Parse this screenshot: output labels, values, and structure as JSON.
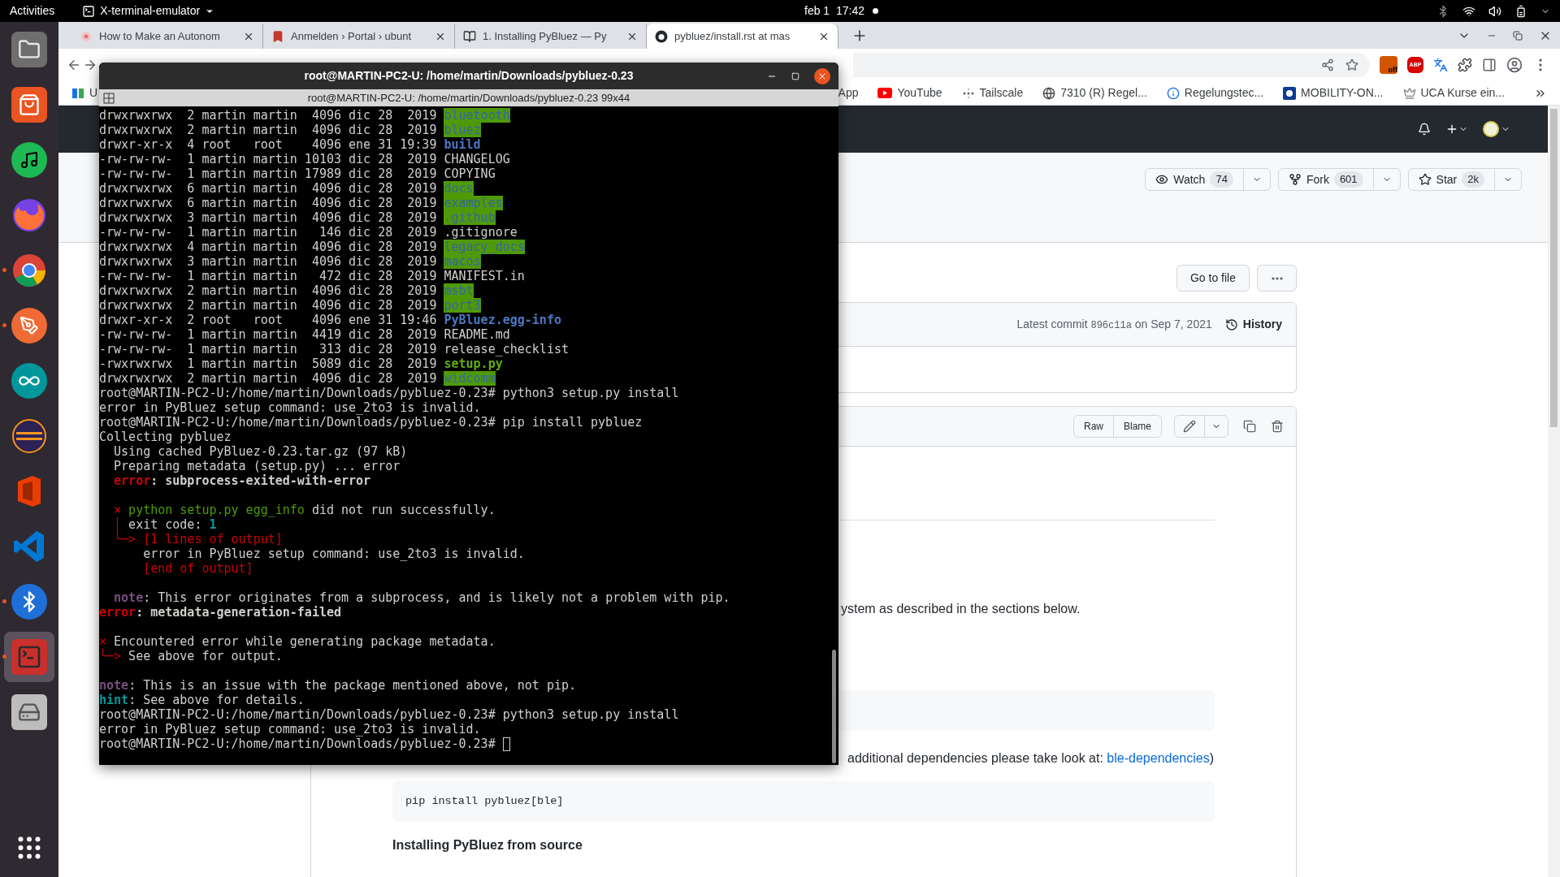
{
  "top_bar": {
    "activities": "Activities",
    "app_menu": "X-terminal-emulator",
    "clock": "feb 1  17:42",
    "notification": true
  },
  "dock": {
    "items": [
      {
        "kind": "files",
        "running": false,
        "selected": false
      },
      {
        "kind": "store",
        "running": false,
        "selected": false
      },
      {
        "kind": "music",
        "running": false,
        "selected": false
      },
      {
        "kind": "fox",
        "running": false,
        "selected": false
      },
      {
        "kind": "chrome",
        "running": true,
        "selected": false
      },
      {
        "kind": "pen",
        "running": true,
        "selected": false
      },
      {
        "kind": "infinity",
        "running": false,
        "selected": false
      },
      {
        "kind": "eclipse",
        "running": false,
        "selected": false
      },
      {
        "kind": "office",
        "running": false,
        "selected": false
      },
      {
        "kind": "code",
        "running": false,
        "selected": false
      },
      {
        "kind": "bluetooth",
        "running": true,
        "selected": false
      },
      {
        "kind": "terminal",
        "running": true,
        "selected": true
      },
      {
        "kind": "drive",
        "running": false,
        "selected": false
      }
    ]
  },
  "browser": {
    "tabs": [
      {
        "title": "How to Make an Autonom",
        "selected": false
      },
      {
        "title": "Anmelden › Portal › ubunt",
        "selected": false
      },
      {
        "title": "1. Installing PyBluez — Py",
        "selected": false
      },
      {
        "title": "pybluez/install.rst at mas",
        "selected": true
      }
    ],
    "extensions": [
      {
        "kind": "badge",
        "label": "off"
      },
      {
        "kind": "octagon",
        "label": "ABP"
      },
      {
        "kind": "translate"
      },
      {
        "kind": "puzzle"
      }
    ],
    "bookmarks": [
      {
        "label": "U"
      },
      {
        "label": "App"
      },
      {
        "label": "YouTube"
      },
      {
        "label": "Tailscale"
      },
      {
        "label": "7310 (R) Regel..."
      },
      {
        "label": "Regelungstec..."
      },
      {
        "label": "MOBILITY-ON..."
      },
      {
        "label": "UCA Kurse ein..."
      }
    ]
  },
  "github": {
    "watch": {
      "label": "Watch",
      "count": "74"
    },
    "fork": {
      "label": "Fork",
      "count": "601"
    },
    "star": {
      "label": "Star",
      "count": "2k"
    },
    "go_to_file": "Go to file",
    "commit": {
      "prefix": "Latest commit",
      "sha": "896c11a",
      "date": "on Sep 7, 2021"
    },
    "history": "History",
    "file_buttons": [
      "Raw",
      "Blame"
    ],
    "paragraph_1": "ystem as described in the sections below.",
    "paragraph_2": {
      "text": "additional dependencies please take look at:",
      "link": "ble-dependencies",
      "suffix": ")"
    },
    "code_block": "pip install pybluez[ble]",
    "heading": "Installing PyBluez from source"
  },
  "terminal": {
    "title": "root@MARTIN-PC2-U: /home/martin/Downloads/pybluez-0.23",
    "subtitle": "root@MARTIN-PC2-U: /home/martin/Downloads/pybluez-0.23 99x44",
    "cursor": true,
    "lines": [
      {
        "segments": [
          {
            "text": "drwxrwxrwx  2 martin martin  4096 dic 28  2019 ",
            "kind": "plain"
          },
          {
            "text": "bluetooth",
            "kind": "dir"
          }
        ]
      },
      {
        "segments": [
          {
            "text": "drwxrwxrwx  2 martin martin  4096 dic 28  2019 ",
            "kind": "plain"
          },
          {
            "text": "bluez",
            "kind": "dir"
          }
        ]
      },
      {
        "segments": [
          {
            "text": "drwxr-xr-x  4 root   root    4096 ene 31 19:39 ",
            "kind": "plain"
          },
          {
            "text": "build",
            "kind": "dirbold"
          }
        ]
      },
      {
        "segments": [
          {
            "text": "-rw-rw-rw-  1 martin martin 10103 dic 28  2019 CHANGELOG",
            "kind": "plain"
          }
        ]
      },
      {
        "segments": [
          {
            "text": "-rw-rw-rw-  1 martin martin 17989 dic 28  2019 COPYING",
            "kind": "plain"
          }
        ]
      },
      {
        "segments": [
          {
            "text": "drwxrwxrwx  6 martin martin  4096 dic 28  2019 ",
            "kind": "plain"
          },
          {
            "text": "docs",
            "kind": "dir"
          }
        ]
      },
      {
        "segments": [
          {
            "text": "drwxrwxrwx  6 martin martin  4096 dic 28  2019 ",
            "kind": "plain"
          },
          {
            "text": "examples",
            "kind": "dir"
          }
        ]
      },
      {
        "segments": [
          {
            "text": "drwxrwxrwx  3 martin martin  4096 dic 28  2019 ",
            "kind": "plain"
          },
          {
            "text": ".github",
            "kind": "dir"
          }
        ]
      },
      {
        "segments": [
          {
            "text": "-rw-rw-rw-  1 martin martin   146 dic 28  2019 .gitignore",
            "kind": "plain"
          }
        ]
      },
      {
        "segments": [
          {
            "text": "drwxrwxrwx  4 martin martin  4096 dic 28  2019 ",
            "kind": "plain"
          },
          {
            "text": "legacy_docs",
            "kind": "dir"
          }
        ]
      },
      {
        "segments": [
          {
            "text": "drwxrwxrwx  3 martin martin  4096 dic 28  2019 ",
            "kind": "plain"
          },
          {
            "text": "macos",
            "kind": "dir"
          }
        ]
      },
      {
        "segments": [
          {
            "text": "-rw-rw-rw-  1 martin martin   472 dic 28  2019 MANIFEST.in",
            "kind": "plain"
          }
        ]
      },
      {
        "segments": [
          {
            "text": "drwxrwxrwx  2 martin martin  4096 dic 28  2019 ",
            "kind": "plain"
          },
          {
            "text": "msbt",
            "kind": "dir"
          }
        ]
      },
      {
        "segments": [
          {
            "text": "drwxrwxrwx  2 martin martin  4096 dic 28  2019 ",
            "kind": "plain"
          },
          {
            "text": "port3",
            "kind": "dir"
          }
        ]
      },
      {
        "segments": [
          {
            "text": "drwxr-xr-x  2 root   root    4096 ene 31 19:46 ",
            "kind": "plain"
          },
          {
            "text": "PyBluez.egg-info",
            "kind": "dirbold"
          }
        ]
      },
      {
        "segments": [
          {
            "text": "-rw-rw-rw-  1 martin martin  4419 dic 28  2019 README.md",
            "kind": "plain"
          }
        ]
      },
      {
        "segments": [
          {
            "text": "-rw-rw-rw-  1 martin martin   313 dic 28  2019 release_checklist",
            "kind": "plain"
          }
        ]
      },
      {
        "segments": [
          {
            "text": "-rwxrwxrwx  1 martin martin  5089 dic 28  2019 ",
            "kind": "plain"
          },
          {
            "text": "setup.py",
            "kind": "exec"
          }
        ]
      },
      {
        "segments": [
          {
            "text": "drwxrwxrwx  2 martin martin  4096 dic 28  2019 ",
            "kind": "plain"
          },
          {
            "text": "widcomm",
            "kind": "dir"
          }
        ]
      },
      {
        "segments": [
          {
            "text": "root@MARTIN-PC2-U:/home/martin/Downloads/pybluez-0.23# python3 setup.py install",
            "kind": "plain"
          }
        ]
      },
      {
        "segments": [
          {
            "text": "error in PyBluez setup command: use_2to3 is invalid.",
            "kind": "plain"
          }
        ]
      },
      {
        "segments": [
          {
            "text": "root@MARTIN-PC2-U:/home/martin/Downloads/pybluez-0.23# pip install pybluez",
            "kind": "plain"
          }
        ]
      },
      {
        "segments": [
          {
            "text": "Collecting pybluez",
            "kind": "plain"
          }
        ]
      },
      {
        "segments": [
          {
            "text": "  Using cached PyBluez-0.23.tar.gz (97 kB)",
            "kind": "plain"
          }
        ]
      },
      {
        "segments": [
          {
            "text": "  Preparing metadata (setup.py) ... error",
            "kind": "plain"
          }
        ]
      },
      {
        "segments": [
          {
            "text": "  error",
            "kind": "redbold"
          },
          {
            "text": ": subprocess-exited-with-error",
            "kind": "bold"
          }
        ]
      },
      {
        "kind": "blank"
      },
      {
        "segments": [
          {
            "text": "  ×",
            "kind": "red"
          },
          {
            "text": " python setup.py egg_info",
            "kind": "green"
          },
          {
            "text": " did not run successfully.",
            "kind": "plain"
          }
        ]
      },
      {
        "segments": [
          {
            "text": "  │",
            "kind": "red"
          },
          {
            "text": " exit code: ",
            "kind": "plain"
          },
          {
            "text": "1",
            "kind": "cyan"
          }
        ]
      },
      {
        "segments": [
          {
            "text": "  ╰─> [1 lines of output]",
            "kind": "red"
          }
        ]
      },
      {
        "segments": [
          {
            "text": "      error in PyBluez setup command: use_2to3 is invalid.",
            "kind": "plain"
          }
        ]
      },
      {
        "segments": [
          {
            "text": "      [end of output]",
            "kind": "red"
          }
        ]
      },
      {
        "kind": "blank"
      },
      {
        "segments": [
          {
            "text": "  note",
            "kind": "purple"
          },
          {
            "text": ": This error originates from a subprocess, and is likely not a problem with pip.",
            "kind": "plain"
          }
        ]
      },
      {
        "segments": [
          {
            "text": "error",
            "kind": "redbold"
          },
          {
            "text": ": metadata-generation-failed",
            "kind": "bold"
          }
        ]
      },
      {
        "kind": "blank"
      },
      {
        "segments": [
          {
            "text": "×",
            "kind": "red"
          },
          {
            "text": " Encountered error while generating package metadata.",
            "kind": "plain"
          }
        ]
      },
      {
        "segments": [
          {
            "text": "╰─>",
            "kind": "red"
          },
          {
            "text": " See above for output.",
            "kind": "plain"
          }
        ]
      },
      {
        "kind": "blank"
      },
      {
        "segments": [
          {
            "text": "note",
            "kind": "purple"
          },
          {
            "text": ": This is an issue with the package mentioned above, not pip.",
            "kind": "plain"
          }
        ]
      },
      {
        "segments": [
          {
            "text": "hint",
            "kind": "cyan"
          },
          {
            "text": ": See above for details.",
            "kind": "plain"
          }
        ]
      },
      {
        "segments": [
          {
            "text": "root@MARTIN-PC2-U:/home/martin/Downloads/pybluez-0.23# python3 setup.py install",
            "kind": "plain"
          }
        ]
      },
      {
        "segments": [
          {
            "text": "error in PyBluez setup command: use_2to3 is invalid.",
            "kind": "plain"
          }
        ]
      },
      {
        "segments": [
          {
            "text": "root@MARTIN-PC2-U:/home/martin/Downloads/pybluez-0.23#",
            "kind": "plain"
          }
        ]
      }
    ]
  }
}
